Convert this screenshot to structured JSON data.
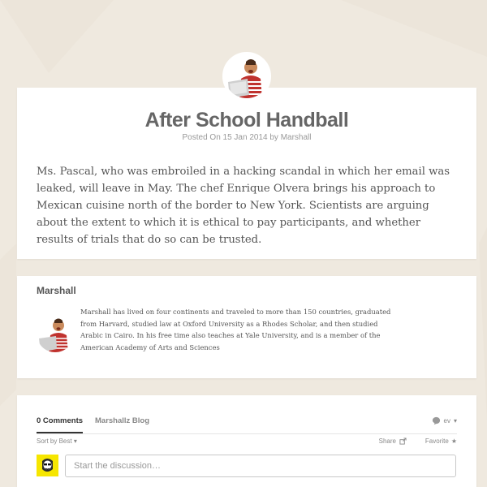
{
  "article": {
    "title": "After School Handball",
    "meta": "Posted On 15 Jan 2014 by Marshall",
    "body": "Ms. Pascal, who was embroiled in a hacking scandal in which her email was leaked, will leave in May. The chef Enrique Olvera brings his approach to Mexican cuisine north of the border to New York. Scientists are arguing about the extent to which it is ethical to pay participants, and whether results of trials that do so can be trusted."
  },
  "author": {
    "name": "Marshall",
    "bio": "Marshall has lived on four continents and traveled to more than 150 countries, graduated from Harvard, studied law at Oxford University as a Rhodes Scholar, and then studied Arabic in Cairo. In his free time also teaches at Yale University, and is a member of the American Academy of Arts and Sciences"
  },
  "comments": {
    "count_label": "0 Comments",
    "blog_label": "Marshallz Blog",
    "user_label": "ev",
    "sort_label": "Sort by Best",
    "share_label": "Share",
    "favorite_label": "Favorite",
    "input_placeholder": "Start the discussion…"
  },
  "icons": {
    "chat": "chat-bubble-icon",
    "share": "share-icon",
    "star": "star-icon",
    "caret": "caret-down-icon"
  },
  "colors": {
    "background": "#efe9df",
    "card": "#ffffff",
    "avatar_yellow": "#f6e600"
  }
}
